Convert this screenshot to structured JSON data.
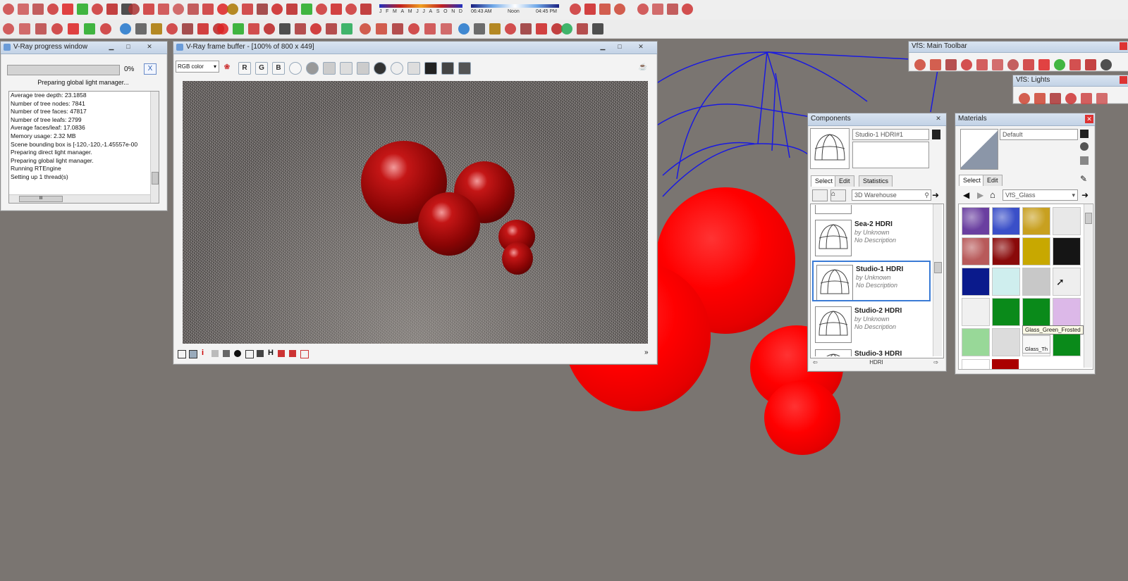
{
  "timeline": {
    "months": [
      "J",
      "F",
      "M",
      "A",
      "M",
      "J",
      "J",
      "A",
      "S",
      "O",
      "N",
      "D"
    ],
    "time_start": "06:43 AM",
    "time_mid": "Noon",
    "time_end": "04:45 PM"
  },
  "progress_window": {
    "title": "V-Ray progress window",
    "percent": "0%",
    "percent_value": 0,
    "close_label": "X",
    "status": "Preparing global light manager...",
    "log": [
      "Average tree depth: 23.1858",
      "Number of tree nodes: 7841",
      "Number of tree faces: 47817",
      "Number of tree leafs: 2799",
      "Average faces/leaf: 17.0836",
      "Memory usage: 2.32 MB",
      "Scene bounding box is [-120,-120,-1.45557e-00",
      "Preparing direct light manager.",
      "Preparing global light manager.",
      "Running RTEngine",
      "Setting up 1 thread(s)"
    ],
    "scroll_mark": "III"
  },
  "frame_buffer": {
    "title": "V-Ray frame buffer - [100% of 800 x 449]",
    "channel": "RGB color",
    "r_label": "R",
    "g_label": "G",
    "b_label": "B",
    "bottom_h1": "H",
    "bottom_i": "i"
  },
  "vfs_main_toolbar": {
    "title": "VfS: Main Toolbar"
  },
  "vfs_lights": {
    "title": "VfS: Lights"
  },
  "components": {
    "title": "Components",
    "selected_name": "Studio-1 HDRI#1",
    "tabs": [
      "Select",
      "Edit",
      "Statistics"
    ],
    "search_value": "3D Warehouse",
    "items": [
      {
        "name": "Sea-2 HDRI",
        "by": "by Unknown",
        "desc": "No Description"
      },
      {
        "name": "Studio-1 HDRI",
        "by": "by Unknown",
        "desc": "No Description"
      },
      {
        "name": "Studio-2 HDRI",
        "by": "by Unknown",
        "desc": "No Description"
      },
      {
        "name": "Studio-3 HDRI",
        "by": "",
        "desc": ""
      }
    ],
    "footer": "HDRI"
  },
  "materials": {
    "title": "Materials",
    "current": "Default",
    "tabs": [
      "Select",
      "Edit"
    ],
    "library": "VfS_Glass",
    "tooltip": "Glass_Green_Frosted",
    "tile_label": "Glass_Th",
    "swatch_colors": [
      "#6a3fa0",
      "#3a4fc8",
      "#c8a020",
      "#e8e8e8",
      "#b85a5a",
      "#8a0a0a",
      "#c8a800",
      "#151515",
      "#0a1a8c",
      "#cfeeee",
      "#c8c8c8",
      "#eeeeee",
      "#f0f0f0",
      "#0a8a1a",
      "#0a8a1a",
      "#dcb8e8",
      "#98d898",
      "#dcdcdc",
      "#f4f4f4",
      "#0a8a1a"
    ]
  }
}
